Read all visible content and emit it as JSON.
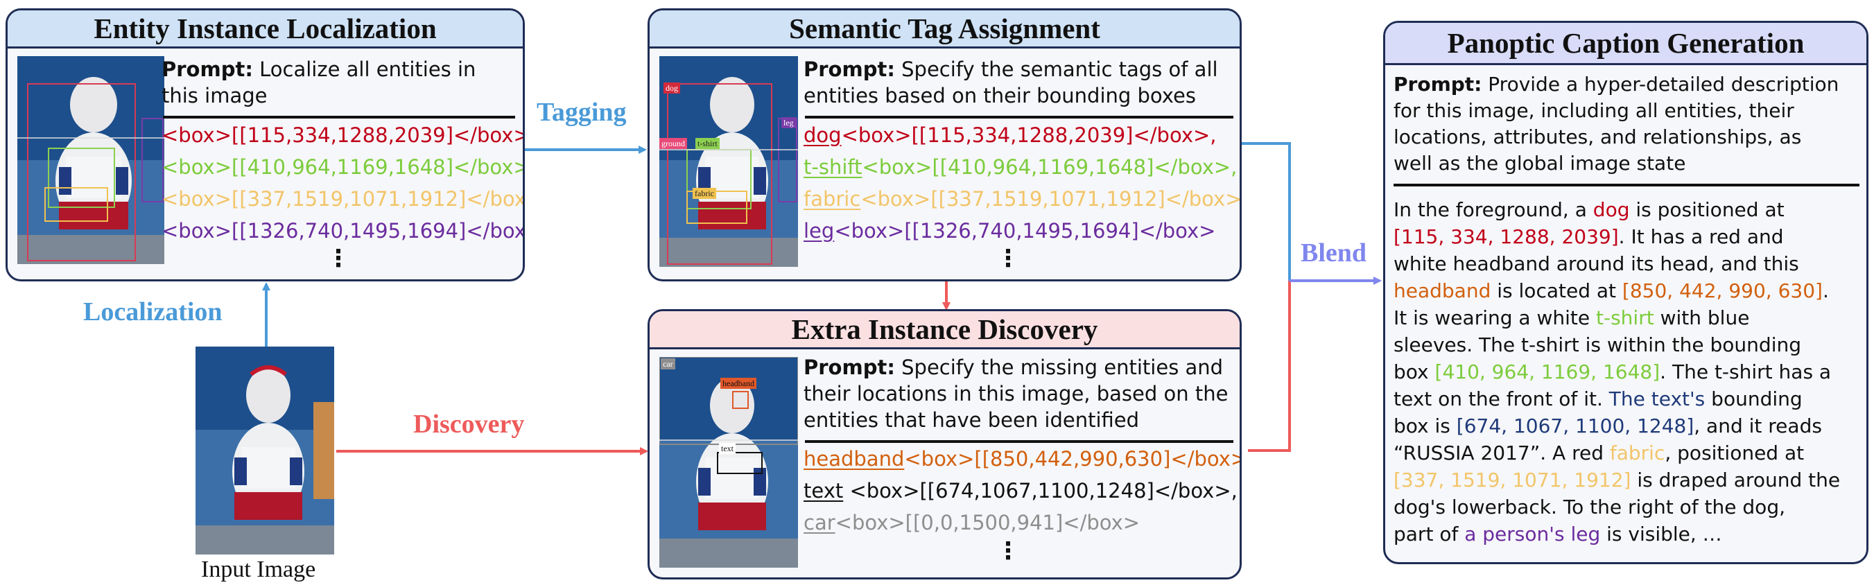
{
  "panels": {
    "localization": {
      "title": "Entity Instance Localization",
      "prompt_label": "Prompt:",
      "prompt_text_1": "Localize all entities in",
      "prompt_text_2": "this image",
      "lines": [
        "<box>[[115,334,1288,2039]</box>,",
        "<box>[[410,964,1169,1648]</box>,",
        "<box>[[337,1519,1071,1912]</box>,",
        "<box>[[1326,740,1495,1694]</box>"
      ],
      "dots": "⋮"
    },
    "tagging": {
      "title": "Semantic Tag Assignment",
      "prompt_label": "Prompt:",
      "prompt_text_1": "Specify the semantic tags of all",
      "prompt_text_2": "entities based on their bounding boxes",
      "lines": [
        {
          "tag": "dog",
          "box": "<box>[[115,334,1288,2039]</box>,"
        },
        {
          "tag": "t-shift",
          "box": "<box>[[410,964,1169,1648]</box>,"
        },
        {
          "tag": "fabric",
          "box": "<box>[[337,1519,1071,1912]</box>,"
        },
        {
          "tag": "leg",
          "box": "<box>[[1326,740,1495,1694]</box>"
        }
      ],
      "image_tags": [
        "dog",
        "ground",
        "t-shirt",
        "leg",
        "fabric"
      ],
      "dots": "⋮"
    },
    "discovery": {
      "title": "Extra Instance Discovery",
      "prompt_label": "Prompt:",
      "prompt_text_1": "Specify the missing entities and",
      "prompt_text_2": "their locations in this image, based on the",
      "prompt_text_3": "entities that have been identified",
      "lines": [
        {
          "tag": "headband",
          "box": "<box>[[850,442,990,630]</box>,"
        },
        {
          "tag": "text",
          "box": " <box>[[674,1067,1100,1248]</box>,"
        },
        {
          "tag": "car",
          "box": "<box>[[0,0,1500,941]</box>"
        }
      ],
      "image_tags": [
        "car",
        "headband",
        "text"
      ],
      "dots": "⋮"
    },
    "caption": {
      "title": "Panoptic Caption Generation",
      "prompt_label": "Prompt:",
      "prompt_lines": [
        "Provide a hyper-detailed description",
        "for this image, including all entities, their",
        "locations, attributes, and relationships, as",
        "well as the global image state"
      ],
      "body": {
        "l1a": "In the foreground, a ",
        "l1b": "dog",
        "l1c": " is positioned at",
        "l2a": "[115, 334, 1288, 2039]",
        "l2b": ". It has a red and",
        "l3": "white headband around its head, and this",
        "l4a": "headband",
        "l4b": " is located at ",
        "l4c": "[850, 442, 990, 630]",
        "l4d": ".",
        "l5a": "It is wearing a white ",
        "l5b": "t-shirt",
        "l5c": " with blue",
        "l6": "sleeves. The t-shirt is within the bounding",
        "l7a": "box ",
        "l7b": "[410, 964, 1169, 1648]",
        "l7c": ". The t-shirt has a",
        "l8a": "text on the front of it. ",
        "l8b": "The text's",
        "l8c": " bounding",
        "l9a": "box is ",
        "l9b": "[674, 1067, 1100, 1248]",
        "l9c": ", and it reads",
        "l10a": "“RUSSIA 2017”.  A red ",
        "l10b": "fabric",
        "l10c": ", positioned at",
        "l11a": "[337, 1519, 1071, 1912] ",
        "l11b": "is draped around the",
        "l12": "dog's lowerback. To the right of the dog,",
        "l13a": "part of ",
        "l13b": "a person's leg",
        "l13c": " is visible, …"
      }
    }
  },
  "arrows": {
    "tagging": "Tagging",
    "localization": "Localization",
    "discovery": "Discovery",
    "blend": "Blend"
  },
  "input_label": "Input Image",
  "colors": {
    "arrow_blue": "#4a9ad8",
    "arrow_red": "#ee5a5a",
    "arrow_purple": "#7f86ee"
  }
}
